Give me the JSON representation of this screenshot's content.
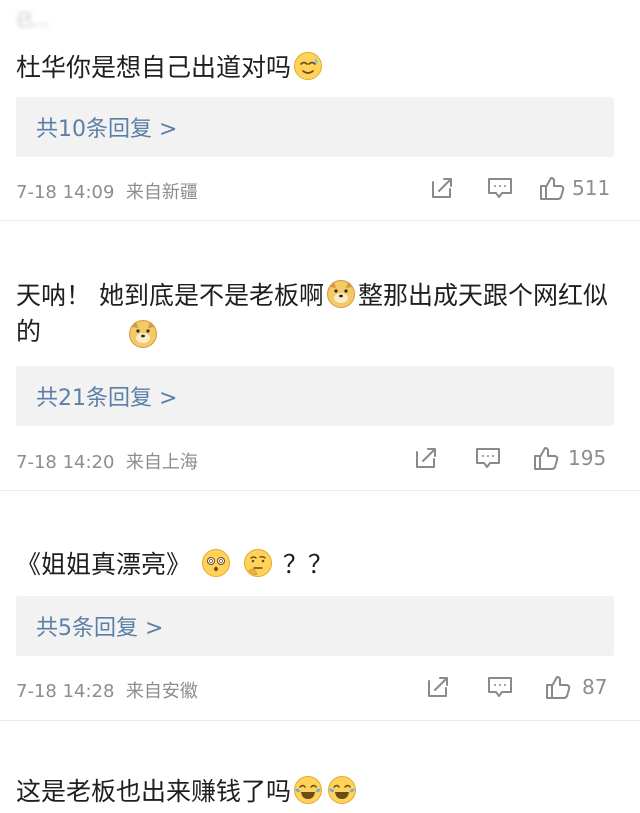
{
  "comments": [
    {
      "username": "已...",
      "text": "杜华你是想自己出道对吗",
      "emojis": [
        "sweat-smile-icon"
      ],
      "replies_label": "共10条回复 >",
      "timestamp": "7-18 14:09",
      "source": "来自新疆",
      "likes": "511"
    },
    {
      "username": "",
      "text_a": "天呐！ 她到底是不是老板啊",
      "text_b": "整那出成天跟个网红似的",
      "emojis": [
        "doge-icon",
        "doge-icon"
      ],
      "replies_label": "共21条回复 >",
      "timestamp": "7-18 14:20",
      "source": "来自上海",
      "likes": "195"
    },
    {
      "username": "",
      "text": "《姐姐真漂亮》",
      "suffix": "？？",
      "emojis": [
        "dizzy-face-icon",
        "thinking-face-icon"
      ],
      "replies_label": "共5条回复 >",
      "timestamp": "7-18 14:28",
      "source": "来自安徽",
      "likes": "87"
    },
    {
      "username": "",
      "text": "这是老板也出来赚钱了吗",
      "emojis": [
        "laugh-cry-icon",
        "laugh-cry-icon"
      ]
    }
  ],
  "colors": {
    "link": "#5b7fa6",
    "meta": "#8d8d8d",
    "reply_bg": "#f2f2f2"
  }
}
